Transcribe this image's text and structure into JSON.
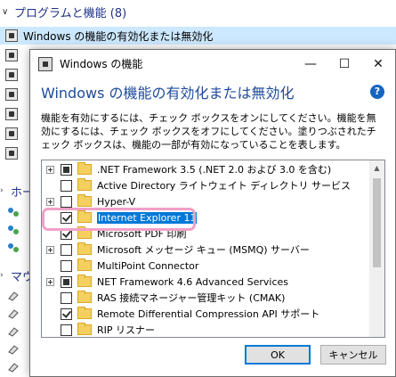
{
  "background": {
    "header": "プログラムと機能 (8)",
    "rows": [
      {
        "label": "Windows の機能の有効化または無効化",
        "selected": true
      },
      {
        "label": "",
        "selected": false
      },
      {
        "label": "",
        "selected": false
      },
      {
        "label": "",
        "selected": false
      },
      {
        "label": "",
        "selected": false
      },
      {
        "label": "",
        "selected": false
      },
      {
        "label": "",
        "selected": false
      }
    ],
    "section1": "ホー",
    "section2": "マウ"
  },
  "dialog": {
    "title": "Windows の機能",
    "heading": "Windows の機能の有効化または無効化",
    "help": "?",
    "minimize": "—",
    "maximize": "☐",
    "close": "✕",
    "description": "機能を有効にするには、チェック ボックスをオンにしてください。機能を無効にするには、チェック ボックスをオフにしてください。塗りつぶされたチェック ボックスは、機能の一部が有効になっていることを表します。",
    "features": [
      {
        "label": ".NET Framework 3.5 (.NET 2.0 および 3.0 を含む)",
        "expandable": true,
        "state": "partial"
      },
      {
        "label": "Active Directory ライトウェイト ディレクトリ サービス",
        "expandable": false,
        "state": "unchecked"
      },
      {
        "label": "Hyper-V",
        "expandable": true,
        "state": "unchecked"
      },
      {
        "label": "Internet Explorer 11",
        "expandable": false,
        "state": "checked",
        "selected": true
      },
      {
        "label": "Microsoft PDF 印刷",
        "expandable": false,
        "state": "checked"
      },
      {
        "label": "Microsoft メッセージ キュー (MSMQ) サーバー",
        "expandable": true,
        "state": "unchecked"
      },
      {
        "label": "MultiPoint Connector",
        "expandable": false,
        "state": "unchecked"
      },
      {
        "label": "NET Framework 4.6 Advanced Services",
        "expandable": true,
        "state": "partial"
      },
      {
        "label": "RAS 接続マネージャー管理キット (CMAK)",
        "expandable": false,
        "state": "unchecked"
      },
      {
        "label": "Remote Differential Compression API サポート",
        "expandable": false,
        "state": "checked"
      },
      {
        "label": "RIP リスナー",
        "expandable": false,
        "state": "unchecked"
      }
    ],
    "ok_label": "OK",
    "cancel_label": "キャンセル"
  },
  "colors": {
    "heading": "#1e4b9b",
    "selection": "#0078d7",
    "annotation": "#f0a0c8",
    "folder": "#f5cf60"
  }
}
